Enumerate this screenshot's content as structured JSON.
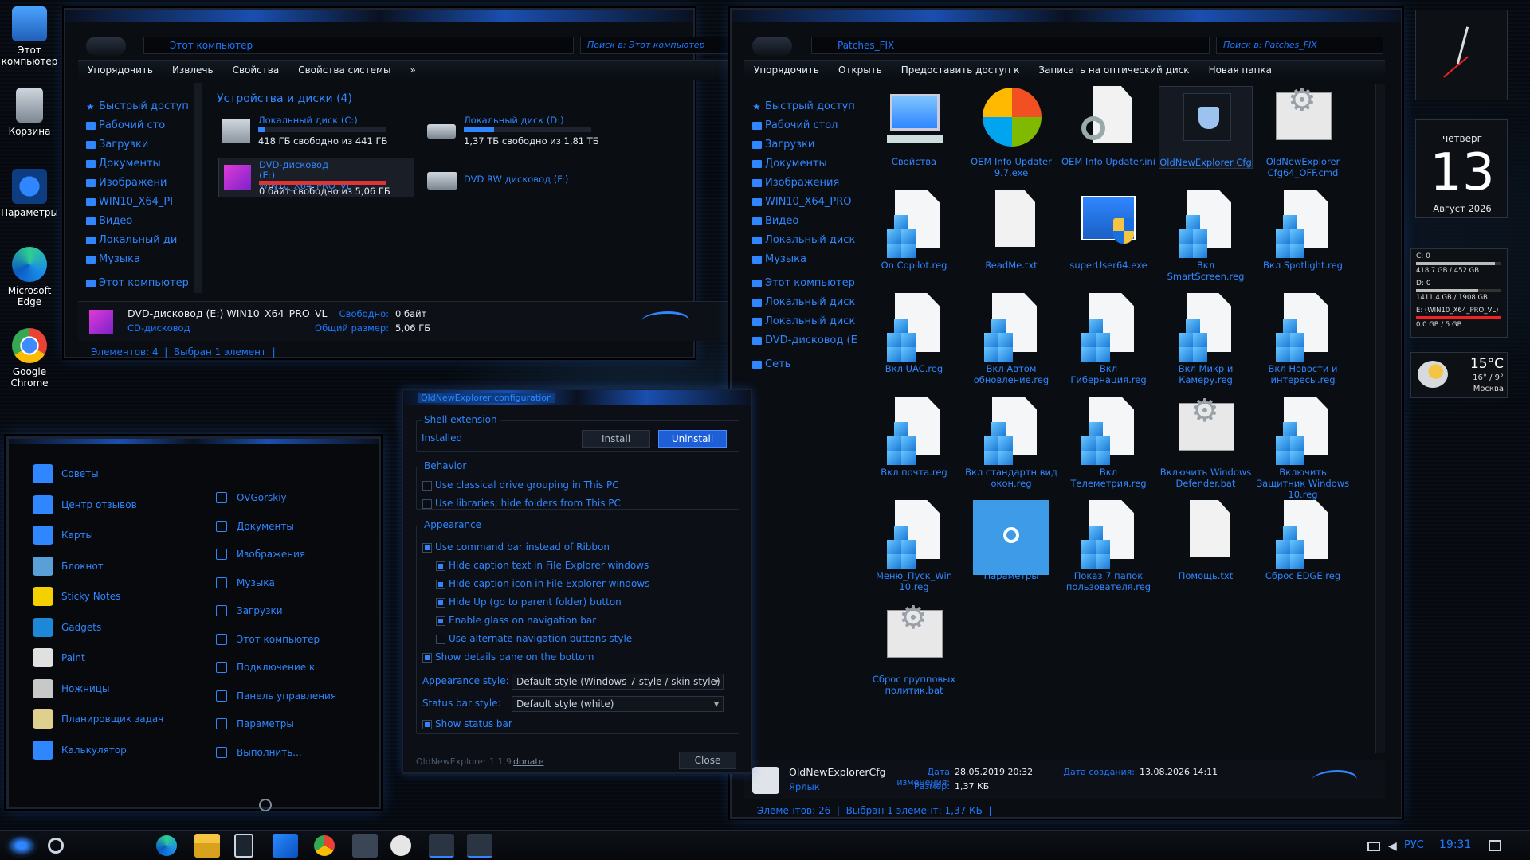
{
  "desktop_icons": [
    {
      "label": "Этот компьютер",
      "icon": "computer-icon"
    },
    {
      "label": "Корзина",
      "icon": "recycle-bin-icon"
    },
    {
      "label": "Параметры",
      "icon": "settings-gear-icon"
    },
    {
      "label": "Microsoft Edge",
      "icon": "edge-icon"
    },
    {
      "label": "Google Chrome",
      "icon": "chrome-icon"
    }
  ],
  "left_explorer": {
    "address": "Этот компьютер",
    "search_placeholder": "Поиск в: Этот компьютер",
    "toolbar": [
      "Упорядочить",
      "Извлечь",
      "Свойства",
      "Свойства системы",
      "»"
    ],
    "nav": [
      "Быстрый доступ",
      "Рабочий сто",
      "Загрузки",
      "Документы",
      "Изображени",
      "WIN10_X64_PI",
      "Видео",
      "Локальный ди",
      "Музыка",
      "Этот компьютер"
    ],
    "group_header": "Устройства и диски (4)",
    "drives": [
      {
        "name": "Локальный диск (C:)",
        "free": "418 ГБ свободно из 441 ГБ",
        "fill": 0.05
      },
      {
        "name": "Локальный диск (D:)",
        "free": "1,37 ТБ свободно из 1,81 ТБ",
        "fill": 0.24
      },
      {
        "name": "DVD-дисковод (E:) WIN10_X64_PRO_VL",
        "free": "0 байт свободно из 5,06 ГБ",
        "fill": 1.0
      },
      {
        "name": "DVD RW дисковод (F:)",
        "free": "",
        "fill": 0
      }
    ],
    "details": {
      "title": "DVD-дисковод (E:) WIN10_X64_PRO_VL",
      "subtitle": "CD-дисковод",
      "free_label": "Свободно:",
      "free_value": "0 байт",
      "total_label": "Общий размер:",
      "total_value": "5,06 ГБ"
    },
    "status": [
      "Элементов: 4",
      "Выбран 1 элемент"
    ]
  },
  "right_explorer": {
    "address": "Patches_FIX",
    "search_placeholder": "Поиск в: Patches_FIX",
    "toolbar": [
      "Упорядочить",
      "Открыть",
      "Предоставить доступ к",
      "Записать на оптический диск",
      "Новая папка"
    ],
    "nav": [
      "Быстрый доступ",
      "Рабочий стол",
      "Загрузки",
      "Документы",
      "Изображения",
      "WIN10_X64_PRO",
      "Видео",
      "Локальный диск",
      "Музыка",
      "Этот компьютер",
      "Локальный диск",
      "Локальный диск",
      "DVD-дисковод (E",
      "Сеть"
    ],
    "files": [
      {
        "label": "Свойства",
        "type": "sys"
      },
      {
        "label": "OEM Info Updater 9.7.exe",
        "type": "oem"
      },
      {
        "label": "OEM Info Updater.ini",
        "type": "ini"
      },
      {
        "label": "OldNewExplorer Cfg",
        "type": "cfg"
      },
      {
        "label": "OldNewExplorer Cfg64_OFF.cmd",
        "type": "gear"
      },
      {
        "label": "On Copilot.reg",
        "type": "reg"
      },
      {
        "label": "ReadMe.txt",
        "type": "txt"
      },
      {
        "label": "superUser64.exe",
        "type": "su"
      },
      {
        "label": "Вкл SmartScreen.reg",
        "type": "reg"
      },
      {
        "label": "Вкл Spotlight.reg",
        "type": "reg"
      },
      {
        "label": "Вкл UAC.reg",
        "type": "reg"
      },
      {
        "label": "Вкл Автом обновление.reg",
        "type": "reg"
      },
      {
        "label": "Вкл Гибернация.reg",
        "type": "reg"
      },
      {
        "label": "Вкл Микр и Камеру.reg",
        "type": "reg"
      },
      {
        "label": "Вкл Новости и интересы.reg",
        "type": "reg"
      },
      {
        "label": "Вкл почта.reg",
        "type": "reg"
      },
      {
        "label": "Вкл стандартн вид окон.reg",
        "type": "reg"
      },
      {
        "label": "Вкл Телеметрия.reg",
        "type": "reg"
      },
      {
        "label": "Включить Windows Defender.bat",
        "type": "gear"
      },
      {
        "label": "Включить Защитник Windows 10.reg",
        "type": "reg"
      },
      {
        "label": "Меню_Пуск_Win 10.reg",
        "type": "reg"
      },
      {
        "label": "Параметры",
        "type": "params"
      },
      {
        "label": "Показ 7 папок пользователя.reg",
        "type": "reg"
      },
      {
        "label": "Помощь.txt",
        "type": "txt"
      },
      {
        "label": "Сброс EDGE.reg",
        "type": "reg"
      },
      {
        "label": "Сброс групповых политик.bat",
        "type": "gear"
      }
    ],
    "details": {
      "name": "OldNewExplorerCfg",
      "type": "Ярлык",
      "modified_label": "Дата изменения:",
      "modified_value": "28.05.2019 20:32",
      "created_label": "Дата создания:",
      "created_value": "13.08.2026 14:11",
      "size_label": "Размер:",
      "size_value": "1,37 КБ"
    },
    "status": [
      "Элементов: 26",
      "Выбран 1 элемент: 1,37 КБ"
    ]
  },
  "dialog": {
    "title": "OldNewExplorer configuration",
    "shell_group": "Shell extension",
    "installed": "Installed",
    "install_btn": "Install",
    "uninstall_btn": "Uninstall",
    "behavior_group": "Behavior",
    "behavior": [
      {
        "label": "Use classical drive grouping in This PC",
        "on": false
      },
      {
        "label": "Use libraries; hide folders from This PC",
        "on": false
      }
    ],
    "appearance_group": "Appearance",
    "appearance": [
      {
        "label": "Use command bar instead of Ribbon",
        "on": true,
        "indent": false
      },
      {
        "label": "Hide caption text in File Explorer windows",
        "on": true,
        "indent": true
      },
      {
        "label": "Hide caption icon in File Explorer windows",
        "on": true,
        "indent": true
      },
      {
        "label": "Hide Up (go to parent folder) button",
        "on": true,
        "indent": true
      },
      {
        "label": "Enable glass on navigation bar",
        "on": true,
        "indent": true
      },
      {
        "label": "Use alternate navigation buttons style",
        "on": false,
        "indent": true
      },
      {
        "label": "Show details pane on the bottom",
        "on": true,
        "indent": false
      }
    ],
    "appearance_style_label": "Appearance style:",
    "appearance_style_value": "Default style (Windows 7 style / skin style)",
    "status_style_label": "Status bar style:",
    "status_style_value": "Default style (white)",
    "show_status": "Show status bar",
    "version": "OldNewExplorer 1.1.9",
    "donate": "donate",
    "close": "Close"
  },
  "start_menu": {
    "left": [
      "Советы",
      "Центр отзывов",
      "Карты",
      "Блокнот",
      "Sticky Notes",
      "Gadgets",
      "Paint",
      "Ножницы",
      "Планировщик задач",
      "Калькулятор"
    ],
    "right": [
      "OVGorskiy",
      "Документы",
      "Изображения",
      "Музыка",
      "Загрузки",
      "Этот компьютер",
      "Подключение к",
      "Панель управления",
      "Параметры",
      "Выполнить..."
    ]
  },
  "gadgets": {
    "calendar": {
      "weekday": "четверг",
      "day": "13",
      "month": "Август 2026"
    },
    "drives": [
      {
        "label": "C: 0",
        "info": "418.7 GB / 452 GB",
        "fill": 0.93
      },
      {
        "label": "D: 0",
        "info": "1411.4 GB / 1908 GB",
        "fill": 0.74
      },
      {
        "label": "E: (WIN10_X64_PRO_VL)",
        "info": "0.0 GB / 5 GB",
        "fill": 1.0
      }
    ],
    "weather": {
      "temp": "15°C",
      "range": "16° / 9°",
      "city": "Москва"
    }
  },
  "taskbar": {
    "lang": "РУС",
    "time": "19:31"
  }
}
